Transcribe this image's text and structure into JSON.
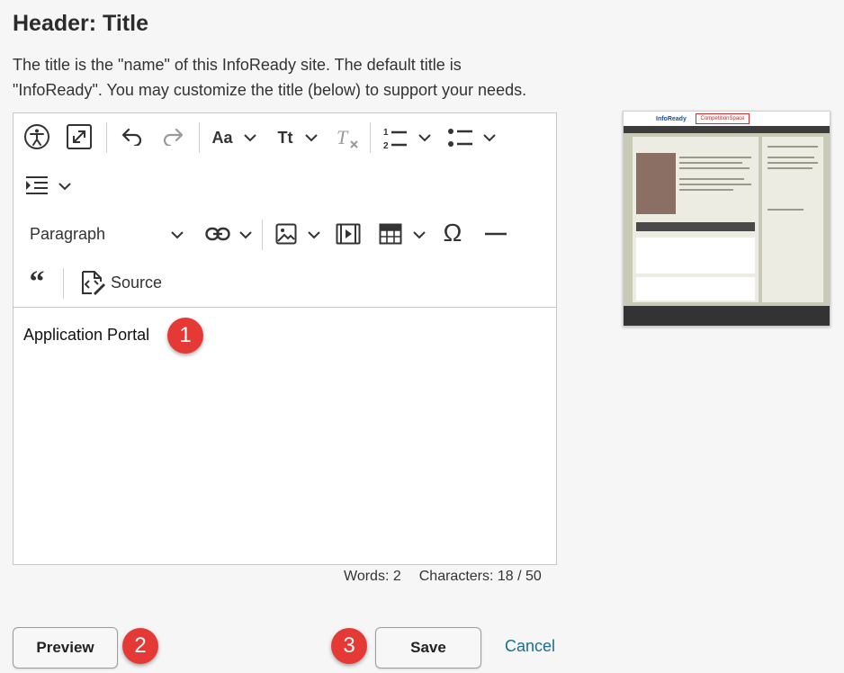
{
  "header": {
    "title": "Header: Title",
    "description": "The title is the \"name\" of this InfoReady site. The default title is \"InfoReady\". You may customize the title (below) to support your needs."
  },
  "toolbar": {
    "paragraph_label": "Paragraph",
    "font_size_label": "Aa",
    "text_style_label": "Tt",
    "source_label": "Source",
    "icons": [
      "accessibility-icon",
      "fullscreen-icon",
      "undo-icon",
      "redo-icon",
      "font-size-icon",
      "text-style-icon",
      "clear-format-icon",
      "numbered-list-icon",
      "bulleted-list-icon",
      "indent-icon",
      "link-icon",
      "image-icon",
      "media-icon",
      "table-icon",
      "special-char-icon",
      "horizontal-line-icon",
      "blockquote-icon",
      "source-icon"
    ]
  },
  "editor": {
    "content": "Application Portal"
  },
  "counter": {
    "words": "Words: 2",
    "characters": "Characters: 18 / 50"
  },
  "buttons": {
    "preview": "Preview",
    "save": "Save",
    "cancel": "Cancel"
  },
  "badges": [
    "1",
    "2",
    "3"
  ],
  "thumbnail": {
    "logo": "InfoReady",
    "highlighted_title": "CompetitionSpace"
  },
  "colors": {
    "badge": "#e53935",
    "link": "#1a6f8e",
    "highlight_box": "#d32f2f"
  }
}
